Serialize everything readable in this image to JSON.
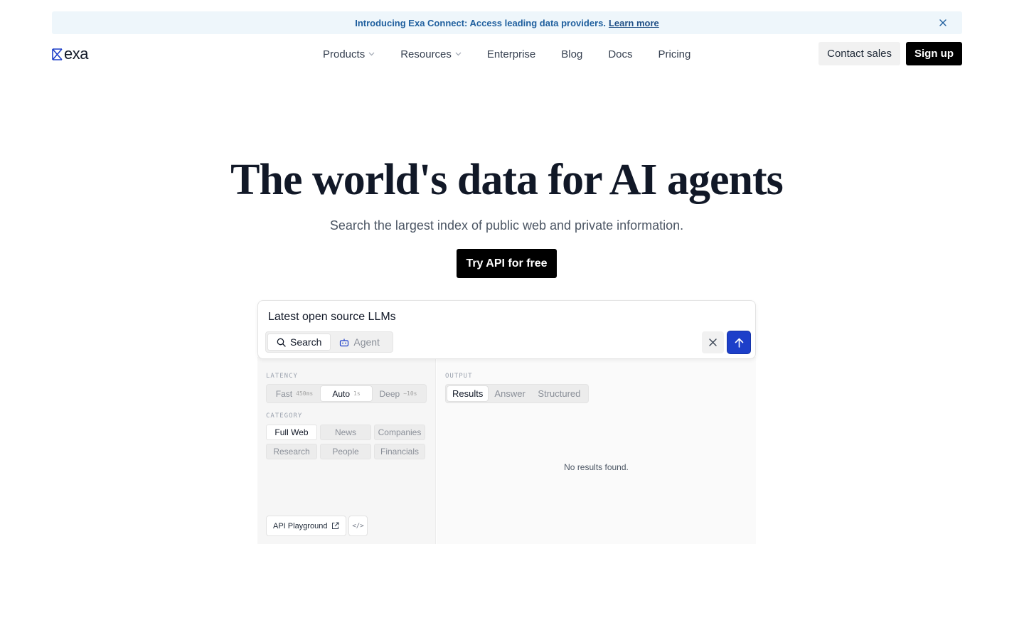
{
  "banner": {
    "text": "Introducing Exa Connect: Access leading data providers.",
    "link": "Learn more"
  },
  "header": {
    "logo_text": "exa",
    "nav": [
      {
        "label": "Products",
        "dropdown": true
      },
      {
        "label": "Resources",
        "dropdown": true
      },
      {
        "label": "Enterprise",
        "dropdown": false
      },
      {
        "label": "Blog",
        "dropdown": false
      },
      {
        "label": "Docs",
        "dropdown": false
      },
      {
        "label": "Pricing",
        "dropdown": false
      }
    ],
    "contact_label": "Contact sales",
    "signup_label": "Sign up"
  },
  "hero": {
    "title": "The world's data for AI agents",
    "subtitle": "Search the largest index of public web and private information.",
    "cta_label": "Try API for free"
  },
  "demo": {
    "query": "Latest open source LLMs",
    "modes": [
      {
        "label": "Search",
        "icon": "search-icon",
        "active": true
      },
      {
        "label": "Agent",
        "icon": "robot-icon",
        "active": false
      }
    ],
    "latency_label": "LATENCY",
    "latency_options": [
      {
        "label": "Fast",
        "hint": "450ms",
        "active": false
      },
      {
        "label": "Auto",
        "hint": "1s",
        "active": true
      },
      {
        "label": "Deep",
        "hint": "~10s",
        "active": false
      }
    ],
    "category_label": "CATEGORY",
    "categories": [
      {
        "label": "Full Web",
        "active": true
      },
      {
        "label": "News",
        "active": false
      },
      {
        "label": "Companies",
        "active": false
      },
      {
        "label": "Research",
        "active": false
      },
      {
        "label": "People",
        "active": false
      },
      {
        "label": "Financials",
        "active": false
      }
    ],
    "output_label": "OUTPUT",
    "output_options": [
      {
        "label": "Results",
        "active": true
      },
      {
        "label": "Answer",
        "active": false
      },
      {
        "label": "Structured",
        "active": false
      }
    ],
    "empty_message": "No results found.",
    "playground_label": "API Playground",
    "code_label": "</>"
  },
  "colors": {
    "accent": "#1d3fc9",
    "banner_bg": "#eef6fb",
    "banner_text": "#1f5f9e"
  }
}
